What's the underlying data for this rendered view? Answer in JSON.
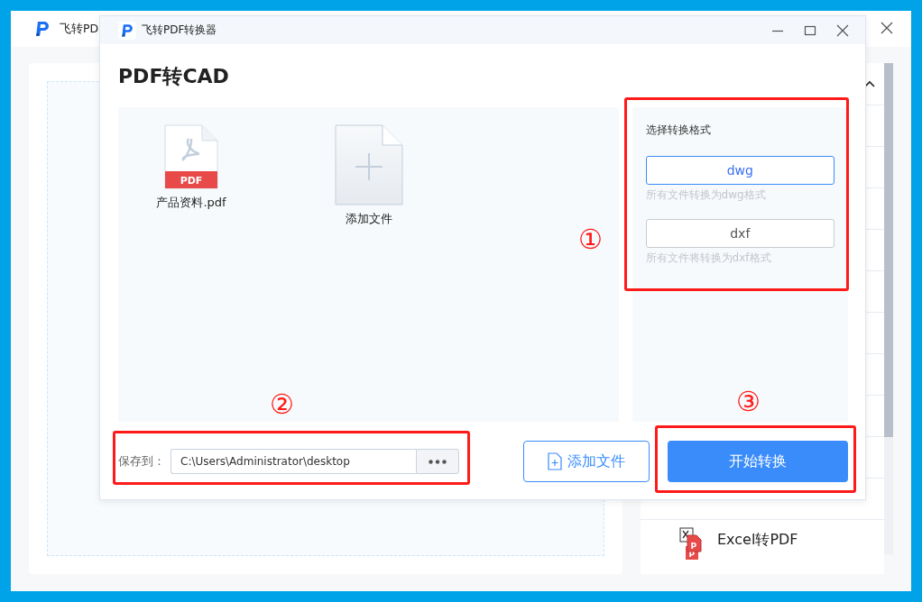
{
  "background_window": {
    "title": "飞转PD",
    "partial_row_badge": "P",
    "sidebar_items": [
      {
        "label": "Excel转PDF",
        "badge": "P"
      }
    ]
  },
  "dialog": {
    "title": "飞转PDF转换器",
    "heading": "PDF转CAD",
    "files": [
      {
        "kind": "pdf",
        "name": "产品资料.pdf",
        "badge": "PDF"
      },
      {
        "kind": "add",
        "name": "添加文件"
      }
    ],
    "format_panel": {
      "label": "选择转换格式",
      "options": [
        {
          "label": "dwg",
          "hint": "所有文件转换为dwg格式",
          "selected": true
        },
        {
          "label": "dxf",
          "hint": "所有文件将转换为dxf格式",
          "selected": false
        }
      ]
    },
    "save": {
      "label": "保存到：",
      "value": "C:\\Users\\Administrator\\desktop"
    },
    "add_button": "添加文件",
    "start_button": "开始转换"
  },
  "annotations": [
    {
      "label": "①"
    },
    {
      "label": "②"
    },
    {
      "label": "③"
    }
  ]
}
